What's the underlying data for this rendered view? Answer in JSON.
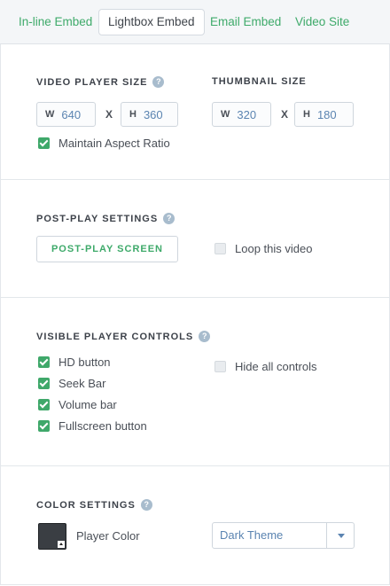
{
  "tabs": [
    {
      "label": "In-line Embed",
      "active": false
    },
    {
      "label": "Lightbox Embed",
      "active": true
    },
    {
      "label": "Email Embed",
      "active": false
    },
    {
      "label": "Video Site",
      "active": false
    }
  ],
  "help_glyph": "?",
  "video_player_size": {
    "heading": "VIDEO PLAYER SIZE",
    "width_prefix": "W",
    "width": "640",
    "height_prefix": "H",
    "height": "360",
    "separator": "X"
  },
  "thumbnail_size": {
    "heading": "THUMBNAIL SIZE",
    "width_prefix": "W",
    "width": "320",
    "height_prefix": "H",
    "height": "180",
    "separator": "X"
  },
  "maintain_aspect_ratio": {
    "label": "Maintain Aspect Ratio",
    "checked": true
  },
  "post_play": {
    "heading": "POST-PLAY SETTINGS",
    "button_label": "POST-PLAY SCREEN",
    "loop": {
      "label": "Loop this video",
      "checked": false
    }
  },
  "player_controls": {
    "heading": "VISIBLE PLAYER CONTROLS",
    "items": [
      {
        "label": "HD button",
        "checked": true
      },
      {
        "label": "Seek Bar",
        "checked": true
      },
      {
        "label": "Volume bar",
        "checked": true
      },
      {
        "label": "Fullscreen button",
        "checked": true
      }
    ],
    "hide_all": {
      "label": "Hide all controls",
      "checked": false
    }
  },
  "color_settings": {
    "heading": "COLOR SETTINGS",
    "player_color_label": "Player Color",
    "player_color": "#3a3e43",
    "theme_selected": "Dark Theme"
  },
  "colors": {
    "accent": "#3eaa6a",
    "value_text": "#5b84b1",
    "help_icon": "#a8bccd"
  }
}
